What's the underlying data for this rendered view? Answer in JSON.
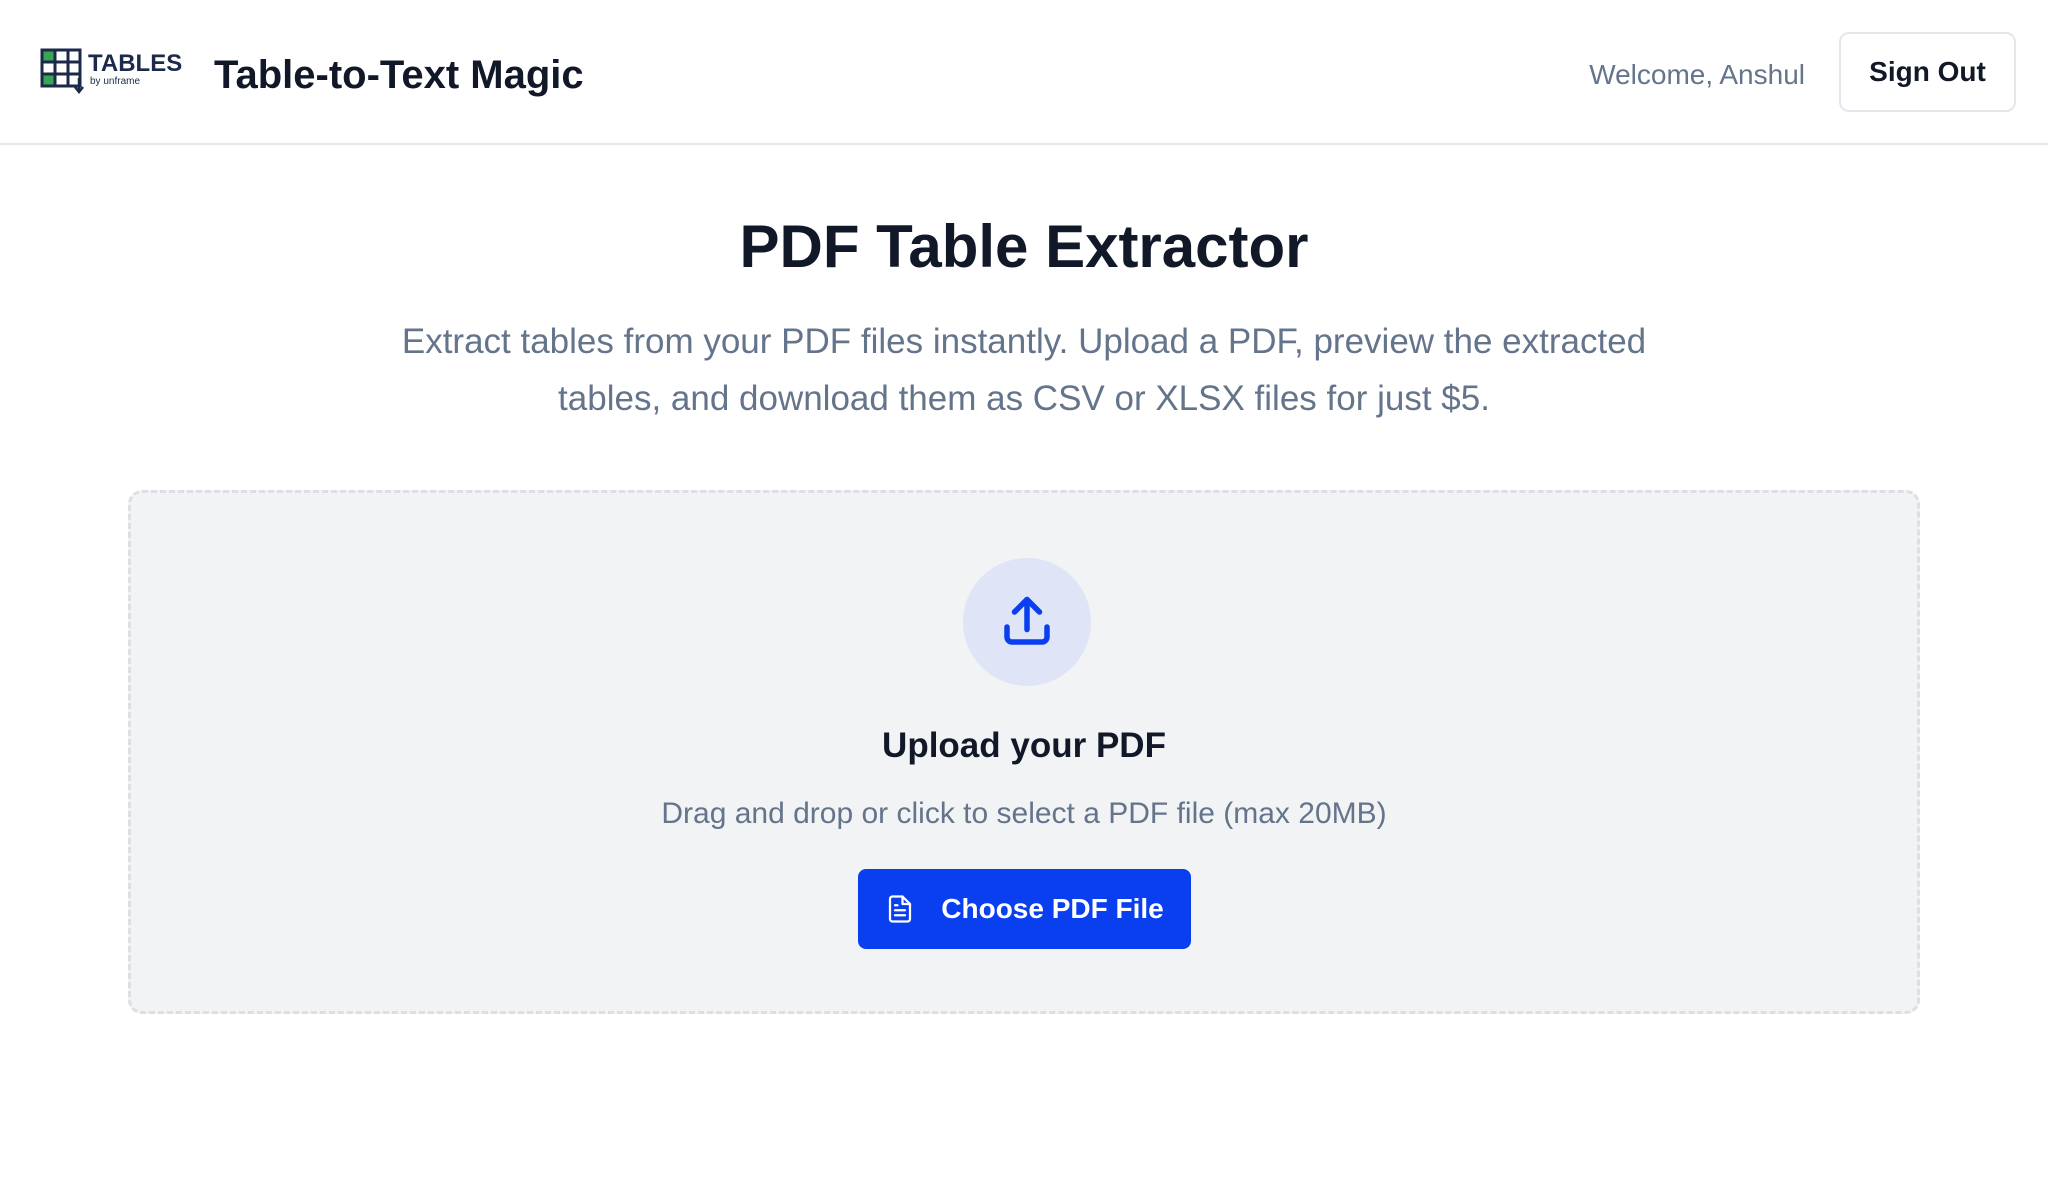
{
  "header": {
    "logo": {
      "word": "TABLES",
      "sub": "by unframe",
      "icon": "table-grid-icon"
    },
    "app_title": "Table-to-Text Magic",
    "welcome_text": "Welcome, Anshul",
    "sign_out_label": "Sign Out"
  },
  "hero": {
    "title": "PDF Table Extractor",
    "subtitle": "Extract tables from your PDF files instantly. Upload a PDF, preview the extracted tables, and download them as CSV or XLSX files for just $5."
  },
  "upload": {
    "icon": "upload-icon",
    "title": "Upload your PDF",
    "hint": "Drag and drop or click to select a PDF file (max 20MB)",
    "button_label": "Choose PDF File",
    "button_icon": "file-text-icon"
  },
  "colors": {
    "accent": "#0a3ff0",
    "upload_circle": "#dfe4f7",
    "dropzone_bg": "#f2f3f5",
    "text_primary": "#111827",
    "text_muted": "#64748b",
    "logo_navy": "#1b2a4a",
    "logo_green": "#3aa655"
  }
}
